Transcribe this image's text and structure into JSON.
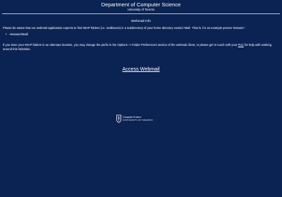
{
  "header": {
    "title": "Department of Computer Science",
    "subtitle": "University of Toronto"
  },
  "main": {
    "section_title": "Webmail Info",
    "intro": "Please be aware that our webmail application expects to find IMAP folders (i.e. mailboxes) in a subdirectory of your home directory named 'Mail'. That is, for an example person 'testuser':",
    "path_item": "~testuser/Mail/",
    "alt_note_before": "If you store your IMAP folders in an alternate location, you may change the prefix in the Options -> Folder Preferences section of the webmail client, or please get in touch with your ",
    "alt_note_link": "PoC",
    "alt_note_after": " for help with working around this limitation.",
    "access_link": "Access Webmail"
  },
  "footer": {
    "logo_line1": "Computer Science",
    "logo_line2": "UNIVERSITY OF TORONTO",
    "logo_icon": "crest-icon"
  },
  "colors": {
    "background": "#0b2352",
    "text": "#ffffff",
    "divider": "#b8c3d8"
  }
}
